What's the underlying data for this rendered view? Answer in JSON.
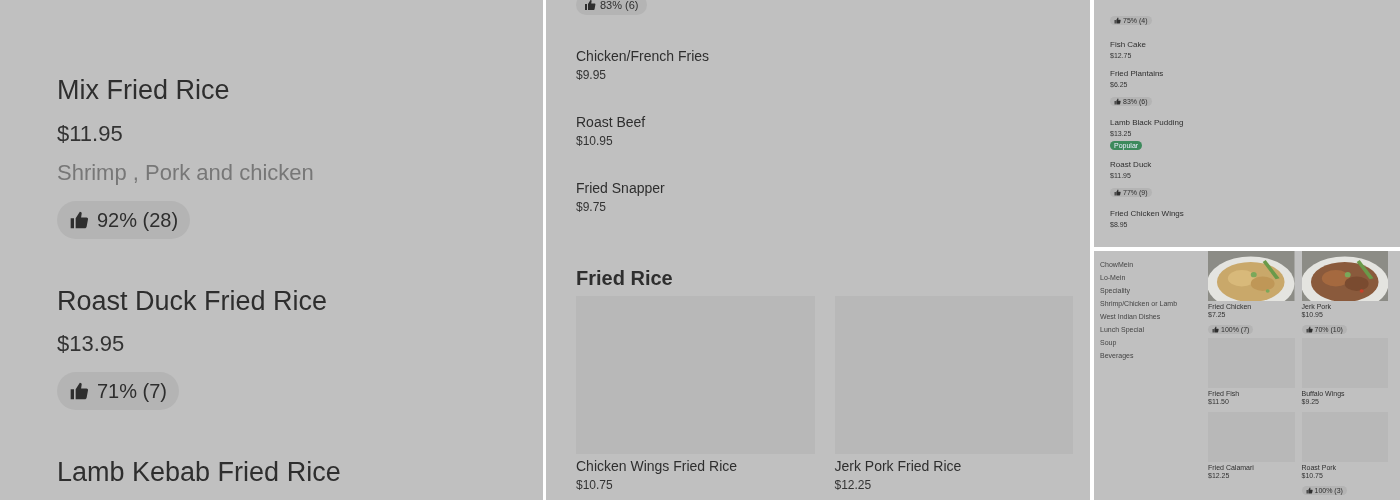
{
  "left_panel": {
    "items": [
      {
        "name": "Mix Fried Rice",
        "price": "$11.95",
        "description": "Shrimp , Pork and chicken",
        "rating": "92% (28)"
      },
      {
        "name": "Roast Duck Fried Rice",
        "price": "$13.95",
        "rating": "71% (7)"
      },
      {
        "name": "Lamb Kebab Fried Rice"
      }
    ]
  },
  "middle_panel": {
    "top_rating": "83% (6)",
    "items": [
      {
        "name": "Chicken/French Fries",
        "price": "$9.95"
      },
      {
        "name": "Roast Beef",
        "price": "$10.95"
      },
      {
        "name": "Fried Snapper",
        "price": "$9.75"
      }
    ],
    "section_title": "Fried Rice",
    "cards": [
      {
        "name": "Chicken Wings Fried Rice",
        "price": "$10.75"
      },
      {
        "name": "Jerk Pork Fried Rice",
        "price": "$12.25"
      }
    ]
  },
  "top_right_panel": {
    "top_rating": "75% (4)",
    "items": [
      {
        "name": "Fish Cake",
        "price": "$12.75"
      },
      {
        "name": "Fried Plantains",
        "price": "$6.25",
        "rating": "83% (6)"
      },
      {
        "name": "Lamb Black Pudding",
        "price": "$13.25",
        "badge": "Popular"
      },
      {
        "name": "Roast Duck",
        "price": "$11.95",
        "rating": "77% (9)"
      },
      {
        "name": "Fried Chicken Wings",
        "price": "$8.95"
      }
    ]
  },
  "bottom_right_panel": {
    "categories": [
      "ChowMein",
      "Lo-Mein",
      "Speciality",
      "Shrimp/Chicken or Lamb",
      "West Indian Dishes",
      "Lunch Special",
      "Soup",
      "Beverages"
    ],
    "cards": [
      {
        "name": "Fried Chicken",
        "price": "$7.25",
        "rating": "100% (7)"
      },
      {
        "name": "Jerk Pork",
        "price": "$10.95",
        "rating": "70% (10)"
      },
      {
        "name": "Fried Fish",
        "price": "$11.50",
        "kind": "placeholder"
      },
      {
        "name": "Buffalo Wings",
        "price": "$9.25",
        "kind": "placeholder"
      },
      {
        "name": "Fried Calamari",
        "price": "$12.25",
        "kind": "placeholder"
      },
      {
        "name": "Roast Pork",
        "price": "$10.75",
        "rating": "100% (3)",
        "kind": "placeholder"
      }
    ]
  }
}
